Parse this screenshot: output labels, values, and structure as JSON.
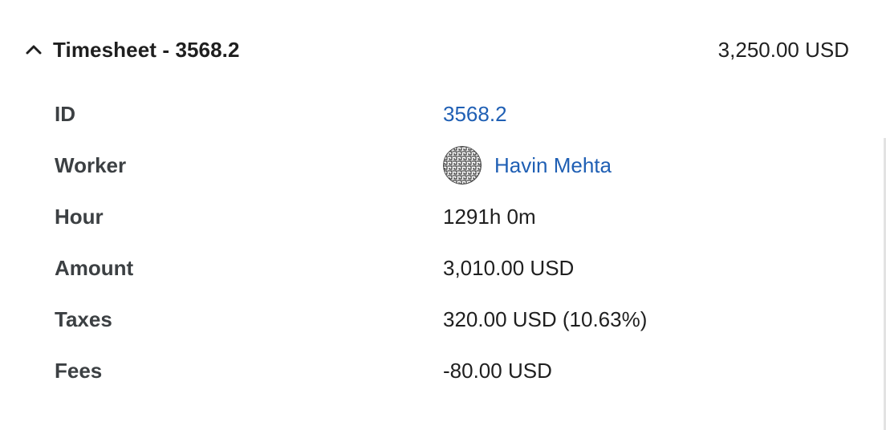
{
  "section": {
    "title": "Timesheet - 3568.2",
    "total": "3,250.00 USD",
    "chevron_icon": "chevron-up-icon"
  },
  "details": {
    "id": {
      "label": "ID",
      "value": "3568.2"
    },
    "worker": {
      "label": "Worker",
      "value": "Havin Mehta",
      "avatar_icon": "avatar-pattern-icon"
    },
    "hour": {
      "label": "Hour",
      "value": "1291h 0m"
    },
    "amount": {
      "label": "Amount",
      "value": "3,010.00 USD"
    },
    "taxes": {
      "label": "Taxes",
      "value": "320.00 USD (10.63%)"
    },
    "fees": {
      "label": "Fees",
      "value": "-80.00 USD"
    }
  },
  "colors": {
    "link": "#1f5fb4",
    "label": "#3c4043",
    "text": "#1f1f1f"
  }
}
